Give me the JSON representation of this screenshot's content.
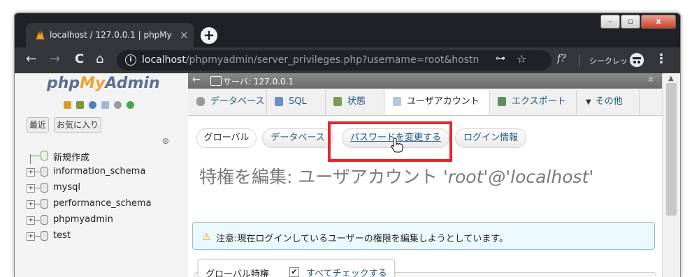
{
  "browser": {
    "tab_title": "localhost / 127.0.0.1 | phpMy",
    "tab_close": "×",
    "new_tab": "+",
    "window_controls": {
      "minimize": "–",
      "maximize": "▫",
      "close": "x"
    },
    "nav": {
      "back": "←",
      "forward": "→",
      "reload": "C",
      "home": "⌂"
    },
    "info_symbol": "i",
    "url_host": "localhost",
    "url_path": "/phpmyadmin/server_privileges.php?username=root&hostn…",
    "key_symbol": "⊶",
    "star_symbol": "☆",
    "ext_symbol": "f?",
    "incognito_label": "シークレット",
    "menu_symbol": "⋮"
  },
  "sidebar": {
    "logo_php": "php",
    "logo_my": "My",
    "logo_admin": "Admin",
    "tabs": [
      "最近",
      "お気に入り"
    ],
    "link_symbol": "⊝",
    "tree": [
      {
        "label": "新規作成",
        "expander": ""
      },
      {
        "label": "information_schema",
        "expander": "+"
      },
      {
        "label": "mysql",
        "expander": "+"
      },
      {
        "label": "performance_schema",
        "expander": "+"
      },
      {
        "label": "phpmyadmin",
        "expander": "+"
      },
      {
        "label": "test",
        "expander": "+"
      }
    ]
  },
  "main": {
    "collapse_symbol": "←",
    "server_label": "サーバ: 127.0.0.1",
    "up_symbol": "⌅",
    "topnav": [
      "データベース",
      "SQL",
      "状態",
      "ユーザアカウント",
      "エクスポート",
      "その他"
    ],
    "more_symbol": "▼",
    "subtabs": [
      "グローバル",
      "データベース",
      "パスワードを変更する",
      "ログイン情報"
    ],
    "title_prefix": "特権を編集: ユーザアカウント ",
    "title_account": "'root'@'localhost'",
    "notice_symbol": "⚠",
    "notice": "注意:現在ログインしているユーザーの権限を編集しようとしています。",
    "global_privileges_label": "グローバル特権",
    "check_all_label": "すべてチェックする",
    "check_all_state": "✔"
  },
  "colors": {
    "highlight": "#e8262e",
    "link": "#235a81",
    "chrome_dark": "#202124"
  }
}
